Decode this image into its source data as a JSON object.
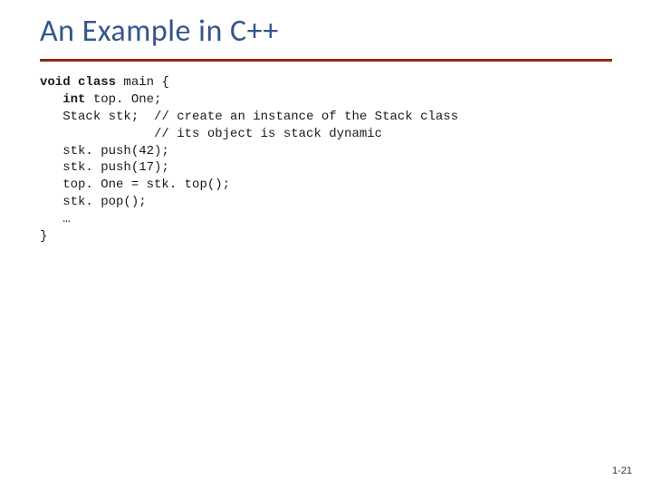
{
  "title": "An Example in C++",
  "code": {
    "kw_void": "void",
    "kw_class": "class",
    "fn_main": " main {",
    "indent": "   ",
    "kw_int": "int",
    "decl_topOne": " top. One;",
    "decl_stk": "Stack stk;  ",
    "cmt1": "// create an instance of the Stack class",
    "cmt2_pad": "               ",
    "cmt2": "// its object is stack dynamic",
    "push42": "stk. push(42);",
    "push17": "stk. push(17);",
    "assign": "top. One = stk. top();",
    "pop": "stk. pop();",
    "ellipsis": "…",
    "close": "}"
  },
  "pagenum": "1-21"
}
